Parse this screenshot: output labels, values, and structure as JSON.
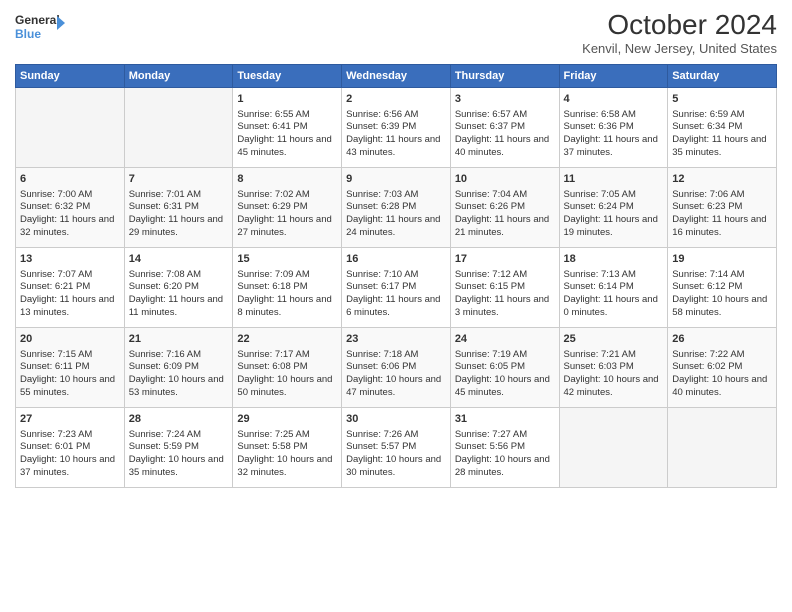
{
  "header": {
    "logo_line1": "General",
    "logo_line2": "Blue",
    "month_title": "October 2024",
    "location": "Kenvil, New Jersey, United States"
  },
  "weekdays": [
    "Sunday",
    "Monday",
    "Tuesday",
    "Wednesday",
    "Thursday",
    "Friday",
    "Saturday"
  ],
  "weeks": [
    [
      {
        "day": "",
        "sunrise": "",
        "sunset": "",
        "daylight": ""
      },
      {
        "day": "",
        "sunrise": "",
        "sunset": "",
        "daylight": ""
      },
      {
        "day": "1",
        "sunrise": "Sunrise: 6:55 AM",
        "sunset": "Sunset: 6:41 PM",
        "daylight": "Daylight: 11 hours and 45 minutes."
      },
      {
        "day": "2",
        "sunrise": "Sunrise: 6:56 AM",
        "sunset": "Sunset: 6:39 PM",
        "daylight": "Daylight: 11 hours and 43 minutes."
      },
      {
        "day": "3",
        "sunrise": "Sunrise: 6:57 AM",
        "sunset": "Sunset: 6:37 PM",
        "daylight": "Daylight: 11 hours and 40 minutes."
      },
      {
        "day": "4",
        "sunrise": "Sunrise: 6:58 AM",
        "sunset": "Sunset: 6:36 PM",
        "daylight": "Daylight: 11 hours and 37 minutes."
      },
      {
        "day": "5",
        "sunrise": "Sunrise: 6:59 AM",
        "sunset": "Sunset: 6:34 PM",
        "daylight": "Daylight: 11 hours and 35 minutes."
      }
    ],
    [
      {
        "day": "6",
        "sunrise": "Sunrise: 7:00 AM",
        "sunset": "Sunset: 6:32 PM",
        "daylight": "Daylight: 11 hours and 32 minutes."
      },
      {
        "day": "7",
        "sunrise": "Sunrise: 7:01 AM",
        "sunset": "Sunset: 6:31 PM",
        "daylight": "Daylight: 11 hours and 29 minutes."
      },
      {
        "day": "8",
        "sunrise": "Sunrise: 7:02 AM",
        "sunset": "Sunset: 6:29 PM",
        "daylight": "Daylight: 11 hours and 27 minutes."
      },
      {
        "day": "9",
        "sunrise": "Sunrise: 7:03 AM",
        "sunset": "Sunset: 6:28 PM",
        "daylight": "Daylight: 11 hours and 24 minutes."
      },
      {
        "day": "10",
        "sunrise": "Sunrise: 7:04 AM",
        "sunset": "Sunset: 6:26 PM",
        "daylight": "Daylight: 11 hours and 21 minutes."
      },
      {
        "day": "11",
        "sunrise": "Sunrise: 7:05 AM",
        "sunset": "Sunset: 6:24 PM",
        "daylight": "Daylight: 11 hours and 19 minutes."
      },
      {
        "day": "12",
        "sunrise": "Sunrise: 7:06 AM",
        "sunset": "Sunset: 6:23 PM",
        "daylight": "Daylight: 11 hours and 16 minutes."
      }
    ],
    [
      {
        "day": "13",
        "sunrise": "Sunrise: 7:07 AM",
        "sunset": "Sunset: 6:21 PM",
        "daylight": "Daylight: 11 hours and 13 minutes."
      },
      {
        "day": "14",
        "sunrise": "Sunrise: 7:08 AM",
        "sunset": "Sunset: 6:20 PM",
        "daylight": "Daylight: 11 hours and 11 minutes."
      },
      {
        "day": "15",
        "sunrise": "Sunrise: 7:09 AM",
        "sunset": "Sunset: 6:18 PM",
        "daylight": "Daylight: 11 hours and 8 minutes."
      },
      {
        "day": "16",
        "sunrise": "Sunrise: 7:10 AM",
        "sunset": "Sunset: 6:17 PM",
        "daylight": "Daylight: 11 hours and 6 minutes."
      },
      {
        "day": "17",
        "sunrise": "Sunrise: 7:12 AM",
        "sunset": "Sunset: 6:15 PM",
        "daylight": "Daylight: 11 hours and 3 minutes."
      },
      {
        "day": "18",
        "sunrise": "Sunrise: 7:13 AM",
        "sunset": "Sunset: 6:14 PM",
        "daylight": "Daylight: 11 hours and 0 minutes."
      },
      {
        "day": "19",
        "sunrise": "Sunrise: 7:14 AM",
        "sunset": "Sunset: 6:12 PM",
        "daylight": "Daylight: 10 hours and 58 minutes."
      }
    ],
    [
      {
        "day": "20",
        "sunrise": "Sunrise: 7:15 AM",
        "sunset": "Sunset: 6:11 PM",
        "daylight": "Daylight: 10 hours and 55 minutes."
      },
      {
        "day": "21",
        "sunrise": "Sunrise: 7:16 AM",
        "sunset": "Sunset: 6:09 PM",
        "daylight": "Daylight: 10 hours and 53 minutes."
      },
      {
        "day": "22",
        "sunrise": "Sunrise: 7:17 AM",
        "sunset": "Sunset: 6:08 PM",
        "daylight": "Daylight: 10 hours and 50 minutes."
      },
      {
        "day": "23",
        "sunrise": "Sunrise: 7:18 AM",
        "sunset": "Sunset: 6:06 PM",
        "daylight": "Daylight: 10 hours and 47 minutes."
      },
      {
        "day": "24",
        "sunrise": "Sunrise: 7:19 AM",
        "sunset": "Sunset: 6:05 PM",
        "daylight": "Daylight: 10 hours and 45 minutes."
      },
      {
        "day": "25",
        "sunrise": "Sunrise: 7:21 AM",
        "sunset": "Sunset: 6:03 PM",
        "daylight": "Daylight: 10 hours and 42 minutes."
      },
      {
        "day": "26",
        "sunrise": "Sunrise: 7:22 AM",
        "sunset": "Sunset: 6:02 PM",
        "daylight": "Daylight: 10 hours and 40 minutes."
      }
    ],
    [
      {
        "day": "27",
        "sunrise": "Sunrise: 7:23 AM",
        "sunset": "Sunset: 6:01 PM",
        "daylight": "Daylight: 10 hours and 37 minutes."
      },
      {
        "day": "28",
        "sunrise": "Sunrise: 7:24 AM",
        "sunset": "Sunset: 5:59 PM",
        "daylight": "Daylight: 10 hours and 35 minutes."
      },
      {
        "day": "29",
        "sunrise": "Sunrise: 7:25 AM",
        "sunset": "Sunset: 5:58 PM",
        "daylight": "Daylight: 10 hours and 32 minutes."
      },
      {
        "day": "30",
        "sunrise": "Sunrise: 7:26 AM",
        "sunset": "Sunset: 5:57 PM",
        "daylight": "Daylight: 10 hours and 30 minutes."
      },
      {
        "day": "31",
        "sunrise": "Sunrise: 7:27 AM",
        "sunset": "Sunset: 5:56 PM",
        "daylight": "Daylight: 10 hours and 28 minutes."
      },
      {
        "day": "",
        "sunrise": "",
        "sunset": "",
        "daylight": ""
      },
      {
        "day": "",
        "sunrise": "",
        "sunset": "",
        "daylight": ""
      }
    ]
  ]
}
